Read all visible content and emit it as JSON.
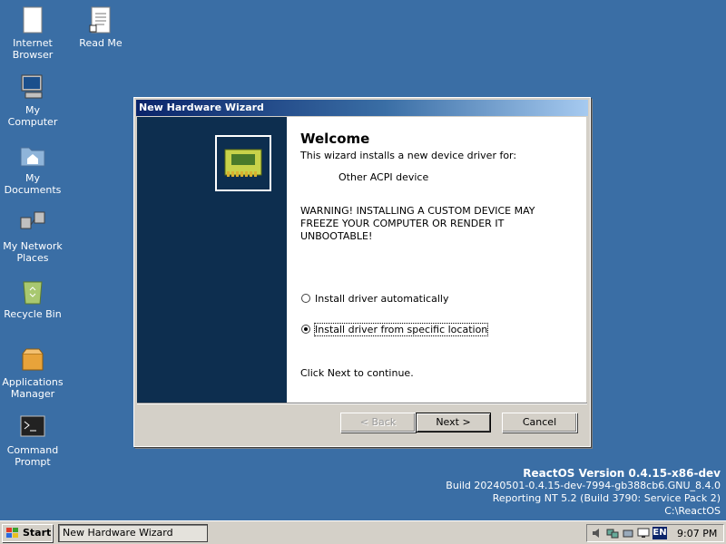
{
  "desktop": {
    "icons": [
      {
        "label": "Internet\nBrowser"
      },
      {
        "label": "Read Me"
      },
      {
        "label": "My\nComputer"
      },
      {
        "label": "My\nDocuments"
      },
      {
        "label": "My Network\nPlaces"
      },
      {
        "label": "Recycle Bin"
      },
      {
        "label": "Applications\nManager"
      },
      {
        "label": "Command\nPrompt"
      }
    ]
  },
  "wizard": {
    "title": "New Hardware Wizard",
    "heading": "Welcome",
    "subtext": "This wizard installs a new device driver for:",
    "device_name": "Other ACPI device",
    "warning": "WARNING! INSTALLING A CUSTOM DEVICE MAY FREEZE YOUR COMPUTER OR RENDER IT UNBOOTABLE!",
    "options": [
      {
        "label": "Install driver automatically",
        "selected": false
      },
      {
        "label": "Install driver from specific location",
        "selected": true
      }
    ],
    "footer_text": "Click Next to continue.",
    "buttons": {
      "back": "< Back",
      "next": "Next >",
      "cancel": "Cancel"
    }
  },
  "os_info": {
    "version": "ReactOS Version 0.4.15-x86-dev",
    "build": "Build 20240501-0.4.15-dev-7994-gb388cb6.GNU_8.4.0",
    "reporting": "Reporting NT 5.2 (Build 3790: Service Pack 2)",
    "path": "C:\\ReactOS"
  },
  "taskbar": {
    "start_label": "Start",
    "task_label": "New Hardware Wizard",
    "language": "EN",
    "clock": "9:07 PM"
  },
  "colors": {
    "desktop": "#3a6ea5",
    "title_start": "#0a246a",
    "wizard_side": "#0d2e4f"
  }
}
